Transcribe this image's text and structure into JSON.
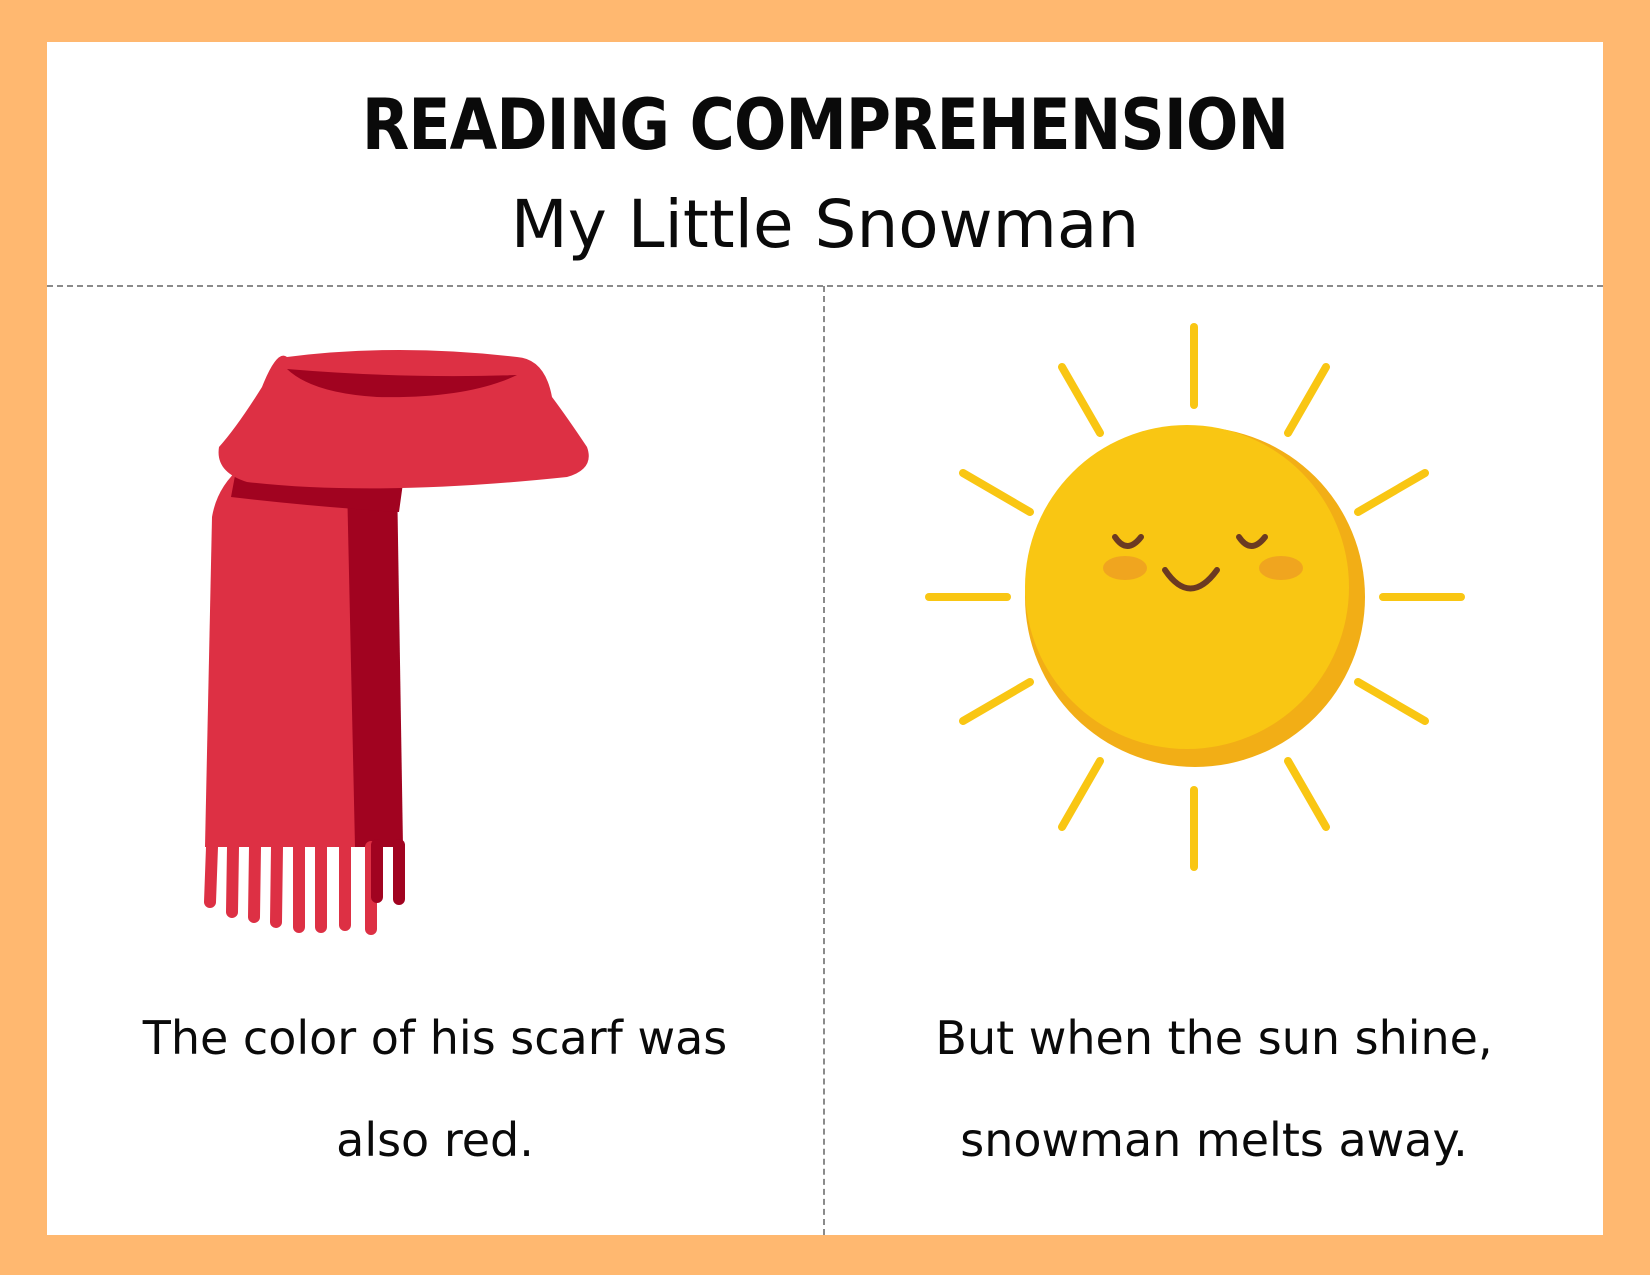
{
  "page": {
    "title": "READING COMPREHENSION",
    "subtitle": "My Little Snowman"
  },
  "panels": [
    {
      "illustration": "red-scarf",
      "caption_lines": [
        "The color of his scarf was",
        "also red."
      ]
    },
    {
      "illustration": "smiling-sun",
      "caption_lines": [
        "But when the sun shine,",
        "snowman melts away."
      ]
    }
  ],
  "colors": {
    "border": "#FFB870",
    "card": "#FFFFFF",
    "scarf": "#DD3044",
    "scarf_shadow": "#A10320",
    "sun": "#F9C613",
    "sun_shadow": "#F2AE16",
    "sun_ray": "#F9C613",
    "cheek": "#F0A51F",
    "face": "#6B3A22"
  }
}
